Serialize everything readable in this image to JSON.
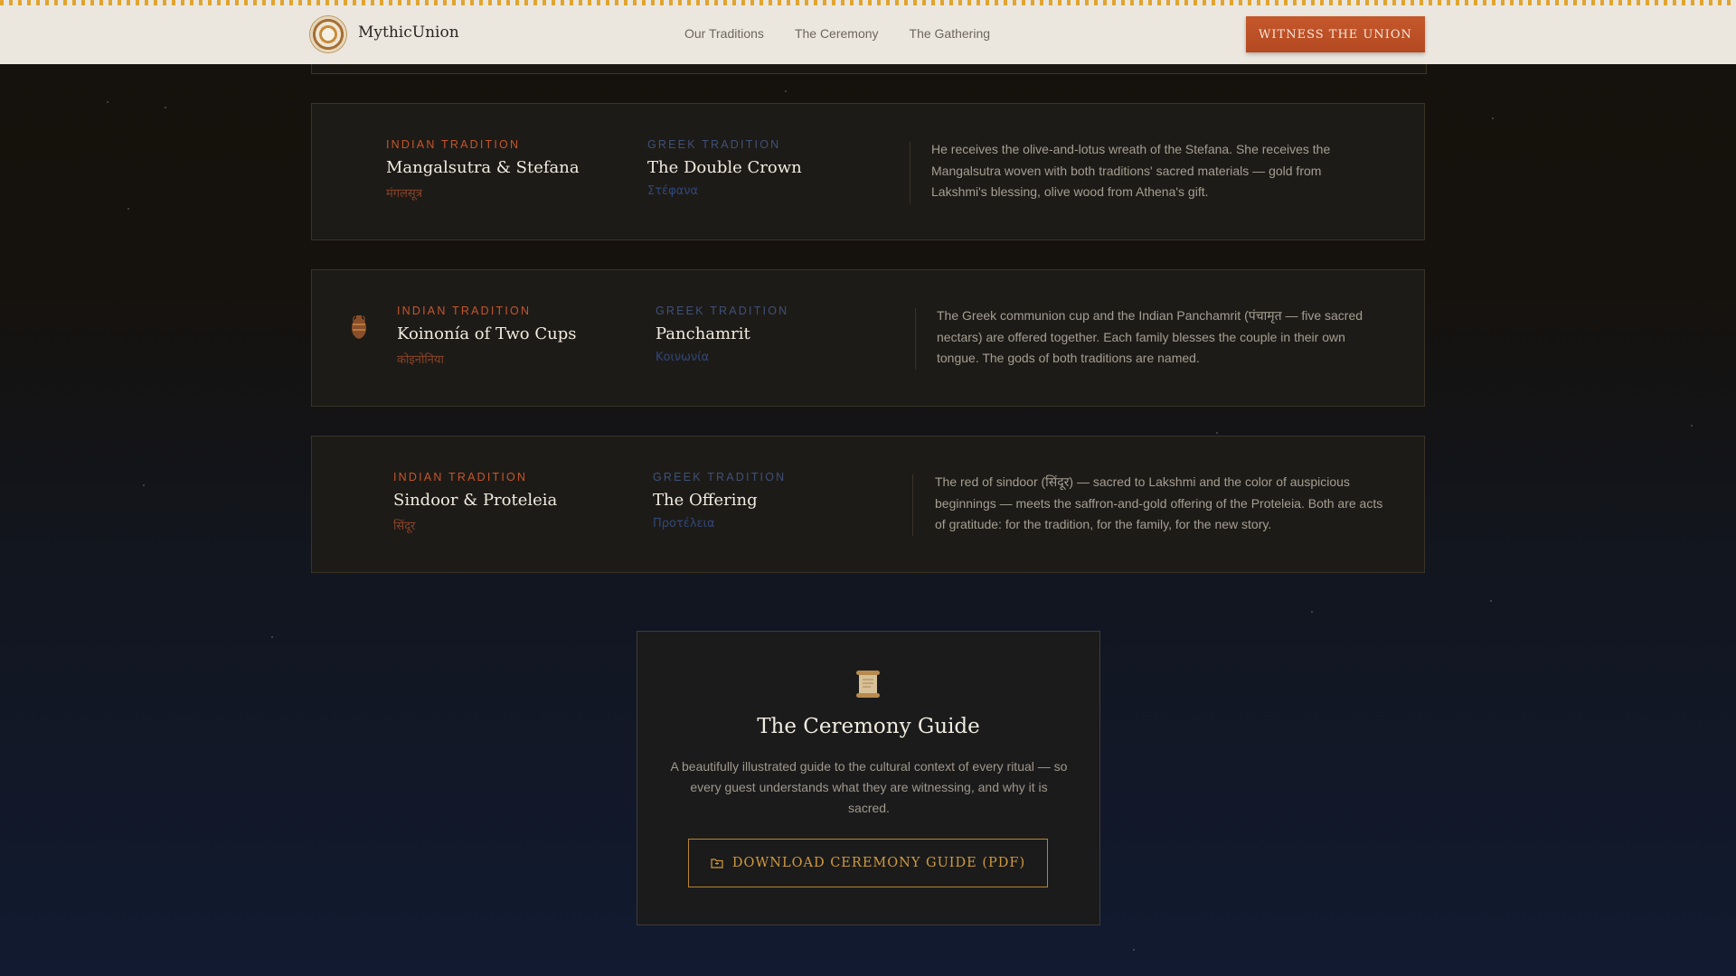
{
  "header": {
    "logo_text": "MythicUnion",
    "nav": [
      "Our Traditions",
      "The Ceremony",
      "The Gathering"
    ],
    "cta_label": "WITNESS THE UNION"
  },
  "rituals": [
    {
      "indian_kicker": "INDIAN TRADITION",
      "indian_name": "Mangalsutra & Stefana",
      "indian_script": "मंगलसूत्र",
      "greek_kicker": "GREEK TRADITION",
      "greek_name": "The Double Crown",
      "greek_script": "Στέφανα",
      "description": "He receives the olive-and-lotus wreath of the Stefana. She receives the Mangalsutra woven with both traditions' sacred materials — gold from Lakshmi's blessing, olive wood from Athena's gift."
    },
    {
      "icon": "amphora-icon",
      "indian_kicker": "INDIAN TRADITION",
      "indian_name": "Koinonía of Two Cups",
      "indian_script": "कोइनोनिया",
      "greek_kicker": "GREEK TRADITION",
      "greek_name": "Panchamrit",
      "greek_script": "Κοινωνία",
      "description": "The Greek communion cup and the Indian Panchamrit (पंचामृत — five sacred nectars) are offered together. Each family blesses the couple in their own tongue. The gods of both traditions are named."
    },
    {
      "indian_kicker": "INDIAN TRADITION",
      "indian_name": "Sindoor & Proteleia",
      "indian_script": "सिंदूर",
      "greek_kicker": "GREEK TRADITION",
      "greek_name": "The Offering",
      "greek_script": "Προτέλεια",
      "description": "The red of sindoor (सिंदूर) — sacred to Lakshmi and the color of auspicious beginnings — meets the saffron-and-gold offering of the Proteleia. Both are acts of gratitude: for the tradition, for the family, for the new story."
    }
  ],
  "guide": {
    "icon": "scroll-icon",
    "title": "The Ceremony Guide",
    "description": "A beautifully illustrated guide to the cultural context of every ritual — so every guest understands what they are witnessing, and why it is sacred.",
    "button_label": "DOWNLOAD CEREMONY GUIDE (PDF)",
    "button_icon": "folder-icon"
  },
  "colors": {
    "accent_orange": "#c5552c",
    "accent_blue": "#3e5179",
    "gold": "#d09a3d"
  }
}
